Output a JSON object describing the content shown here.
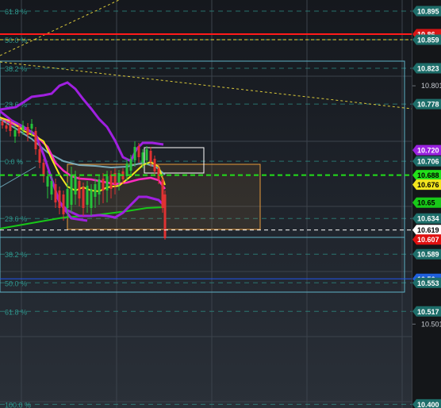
{
  "colors": {
    "background": "#1c2027",
    "grid": "#3c434c",
    "fib_line": "#2e8f86",
    "fib_text": "#2f9a90",
    "candle_up": "#25c23a",
    "candle_down": "#e03232",
    "bollinger": "#a020e0",
    "magenta_ma": "#ff2bbf",
    "yellow_ma": "#f2e51e",
    "green_ma": "#18c818",
    "lightblue_ma": "#7fb7c8",
    "red_level": "#ff1a1a",
    "green_level": "#22e01a",
    "blue_level": "#2255ee",
    "white_level": "#ffffff",
    "channel": "#5fb3c6",
    "box_orange": "#e89a3a"
  },
  "fib_labels": [
    {
      "text": "61.8 %",
      "price": 10.895
    },
    {
      "text": "50.0 %",
      "price": 10.859
    },
    {
      "text": "38.2 %",
      "price": 10.823
    },
    {
      "text": "23.6 %",
      "price": 10.778
    },
    {
      "text": "0.0 %",
      "price": 10.706
    },
    {
      "text": "23.6 %",
      "price": 10.634
    },
    {
      "text": "38.2 %",
      "price": 10.589
    },
    {
      "text": "50.0 %",
      "price": 10.553
    },
    {
      "text": "61.8 %",
      "price": 10.517
    },
    {
      "text": "100.0 %",
      "price": 10.4
    }
  ],
  "price_scale": {
    "levels": [
      "10.895",
      "10.859",
      "10.823",
      "10.801",
      "10.778",
      "10.706",
      "10.634",
      "10.589",
      "10.553",
      "10.517",
      "10.501",
      "10.400"
    ]
  },
  "price_badges": [
    {
      "text": "10.895",
      "price": 10.895,
      "bg": "#1e6e6a",
      "fg": "#ffffff"
    },
    {
      "text": "10.86",
      "price": 10.866,
      "bg": "#d81515",
      "fg": "#ffffff"
    },
    {
      "text": "10.859",
      "price": 10.859,
      "bg": "#1e6e6a",
      "fg": "#ffffff"
    },
    {
      "text": "10.823",
      "price": 10.823,
      "bg": "#1e6e6a",
      "fg": "#ffffff"
    },
    {
      "text": "10.778",
      "price": 10.778,
      "bg": "#1e6e6a",
      "fg": "#ffffff"
    },
    {
      "text": "10.720",
      "price": 10.72,
      "bg": "#9a22e0",
      "fg": "#ffffff"
    },
    {
      "text": "10.706",
      "price": 10.706,
      "bg": "#1e6e6a",
      "fg": "#ffffff"
    },
    {
      "text": "10.688",
      "price": 10.6885,
      "bg": "#22e01a",
      "fg": "#000000"
    },
    {
      "text": "10.676",
      "price": 10.6765,
      "bg": "#f2e51e",
      "fg": "#000000"
    },
    {
      "text": "10.65",
      "price": 10.654,
      "bg": "#18c818",
      "fg": "#000000"
    },
    {
      "text": "10.634",
      "price": 10.634,
      "bg": "#1e6e6a",
      "fg": "#ffffff"
    },
    {
      "text": "10.619",
      "price": 10.6195,
      "bg": "#ffffff",
      "fg": "#000000"
    },
    {
      "text": "10.607",
      "price": 10.6075,
      "bg": "#e01010",
      "fg": "#ffffff"
    },
    {
      "text": "10.589",
      "price": 10.589,
      "bg": "#1e6e6a",
      "fg": "#ffffff"
    },
    {
      "text": "10.56",
      "price": 10.558,
      "bg": "#1f5fdc",
      "fg": "#ffffff"
    },
    {
      "text": "10.553",
      "price": 10.553,
      "bg": "#1e6e6a",
      "fg": "#ffffff"
    },
    {
      "text": "10.517",
      "price": 10.517,
      "bg": "#1e6e6a",
      "fg": "#ffffff"
    },
    {
      "text": "10.400",
      "price": 10.4,
      "bg": "#1e6e6a",
      "fg": "#ffffff"
    }
  ],
  "horizontal_levels": [
    {
      "name": "red-resistance-line",
      "price": 10.866,
      "color": "#ff1a1a",
      "dash": "",
      "width": 2
    },
    {
      "name": "fib-yellow-dashed-line",
      "price": 10.859,
      "color": "#e8d83a",
      "dash": "4,3",
      "width": 1
    },
    {
      "name": "green-dashed-level-line",
      "price": 10.6885,
      "color": "#22e01a",
      "dash": "6,4",
      "width": 2
    },
    {
      "name": "white-dashed-level-line",
      "price": 10.6195,
      "color": "#ffffff",
      "dash": "5,4",
      "width": 1
    },
    {
      "name": "blue-support-line",
      "price": 10.558,
      "color": "#2255ee",
      "dash": "",
      "width": 1
    }
  ]
}
